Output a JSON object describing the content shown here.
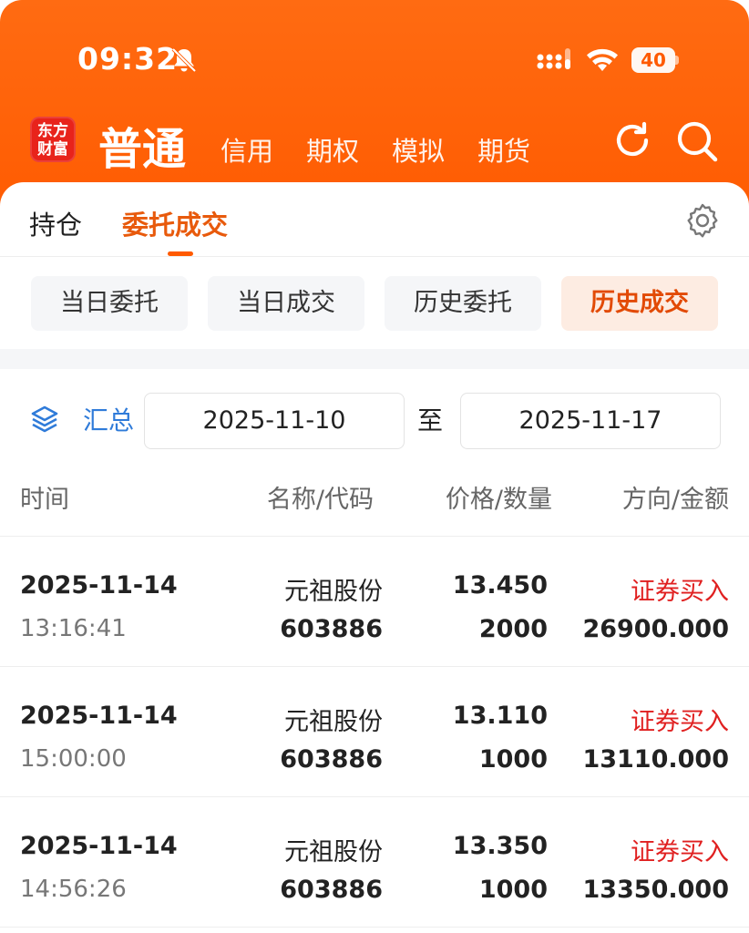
{
  "status_bar": {
    "time": "09:32",
    "battery": "40"
  },
  "header": {
    "logo_line1": "东方",
    "logo_line2": "财富",
    "tabs": [
      {
        "label": "普通",
        "active": true
      },
      {
        "label": "信用"
      },
      {
        "label": "期权"
      },
      {
        "label": "模拟"
      },
      {
        "label": "期货"
      }
    ]
  },
  "subtabs": {
    "hold": "持仓",
    "entrust": "委托成交"
  },
  "segments": [
    {
      "label": "当日委托"
    },
    {
      "label": "当日成交"
    },
    {
      "label": "历史委托"
    },
    {
      "label": "历史成交",
      "active": true
    }
  ],
  "filter": {
    "summary_label": "汇总",
    "start_date": "2025-11-10",
    "to_label": "至",
    "end_date": "2025-11-17"
  },
  "columns": {
    "time": "时间",
    "name_code": "名称/代码",
    "price_qty": "价格/数量",
    "dir_amount": "方向/金额"
  },
  "rows": [
    {
      "date": "2025-11-14",
      "time": "13:16:41",
      "name": "元祖股份",
      "code": "603886",
      "price": "13.450",
      "qty": "2000",
      "direction": "证券买入",
      "amount": "26900.000"
    },
    {
      "date": "2025-11-14",
      "time": "15:00:00",
      "name": "元祖股份",
      "code": "603886",
      "price": "13.110",
      "qty": "1000",
      "direction": "证券买入",
      "amount": "13110.000"
    },
    {
      "date": "2025-11-14",
      "time": "14:56:26",
      "name": "元祖股份",
      "code": "603886",
      "price": "13.350",
      "qty": "1000",
      "direction": "证券买入",
      "amount": "13350.000"
    }
  ]
}
